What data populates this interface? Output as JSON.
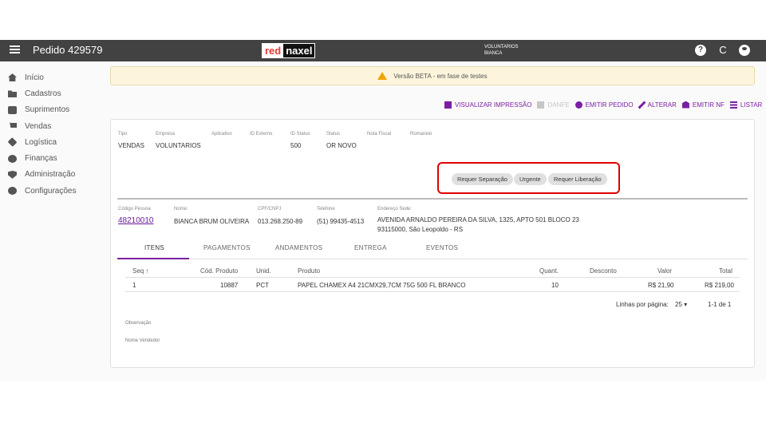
{
  "appbar": {
    "title": "Pedido 429579",
    "logo_red": "red",
    "logo_naxel": "naxel",
    "user_line1": "VOLUNTARIOS",
    "user_line2": "BIANCA",
    "help_icon": "?",
    "refresh_icon": "C"
  },
  "sidebar": {
    "items": [
      {
        "label": "Início",
        "icon": "home-icon"
      },
      {
        "label": "Cadastros",
        "icon": "folder-icon"
      },
      {
        "label": "Suprimentos",
        "icon": "bag-icon"
      },
      {
        "label": "Vendas",
        "icon": "cart-icon"
      },
      {
        "label": "Logística",
        "icon": "logistics-icon"
      },
      {
        "label": "Finanças",
        "icon": "dollar-icon"
      },
      {
        "label": "Administração",
        "icon": "shield-icon"
      },
      {
        "label": "Configurações",
        "icon": "gear-icon"
      }
    ]
  },
  "beta_banner": "Versão BETA - em fase de testes",
  "toolbar": {
    "print": "VISUALIZAR IMPRESSÃO",
    "danfe": "DANFE",
    "emit_order": "EMITIR PEDIDO",
    "edit": "ALTERAR",
    "emit_nf": "EMITIR NF",
    "list": "LISTAR"
  },
  "order": {
    "labels": {
      "tipo": "Tipo",
      "empresa": "Empresa",
      "aplicativo": "Aplicativo",
      "id_externo": "ID Externo",
      "id_status": "ID Status",
      "status": "Status",
      "nota_fiscal": "Nota Fiscal",
      "romaneio": "Romaneio"
    },
    "values": {
      "tipo": "VENDAS",
      "empresa": "VOLUNTARIOS",
      "id_status": "500",
      "status": "OR NOVO"
    },
    "chips": [
      "Requer Separação",
      "Urgente",
      "Requer Liberação"
    ]
  },
  "customer": {
    "labels": {
      "codigo": "Código Pessoa",
      "nome": "Nome:",
      "cpf": "CPF/CNPJ",
      "telefone": "Telefone",
      "endereco": "Endereço Sede:"
    },
    "codigo": "48210010",
    "nome": "BIANCA BRUM OLIVEIRA",
    "cpf": "013.268.250-89",
    "telefone": "(51) 99435-4513",
    "endereco_1": "AVENIDA ARNALDO PEREIRA DA SILVA, 1325, APTO 501 BLOCO 23",
    "endereco_2": "93115000, São Leopoldo - RS"
  },
  "tabs": [
    "ITENS",
    "PAGAMENTOS",
    "ANDAMENTOS",
    "ENTREGA",
    "EVENTOS"
  ],
  "table": {
    "headers": {
      "seq": "Seq",
      "sort_arrow": "↑",
      "cod": "Cód. Produto",
      "unid": "Unid.",
      "produto": "Produto",
      "quant": "Quant.",
      "desconto": "Desconto",
      "valor": "Valor",
      "total": "Total"
    },
    "rows": [
      {
        "seq": "1",
        "cod": "10887",
        "unid": "PCT",
        "produto": "PAPEL CHAMEX A4 21CMX29,7CM 75G 500 FL BRANCO",
        "quant": "10",
        "desconto": "",
        "valor": "R$ 21,90",
        "total": "R$ 219,00"
      }
    ]
  },
  "pagination": {
    "rows_label": "Linhas por página:",
    "rows_value": "25",
    "range": "1-1 de 1"
  },
  "observacao": "Observação",
  "vendedor": "Nome Vendedor",
  "colors": {
    "appbar": "#424242",
    "accent": "#7b1fa2",
    "highlight": "#e00000",
    "banner": "#fcf5dc"
  }
}
